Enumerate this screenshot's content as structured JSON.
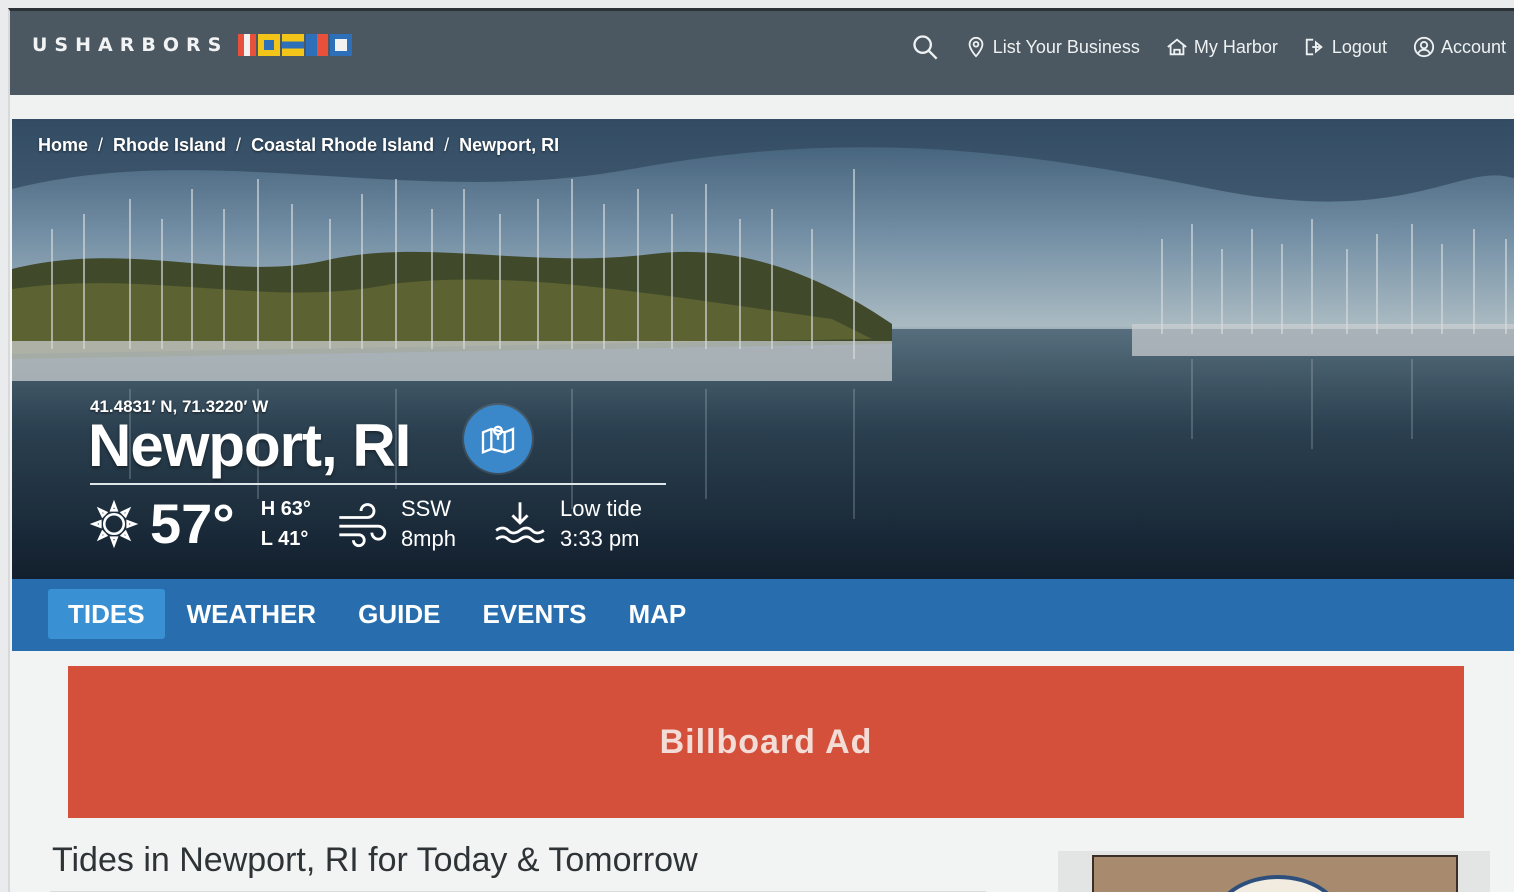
{
  "nav": {
    "logo_text": "USHARBORS",
    "items": [
      {
        "label": "List Your Business",
        "icon": "location-pin-icon"
      },
      {
        "label": "My Harbor",
        "icon": "home-icon"
      },
      {
        "label": "Logout",
        "icon": "logout-icon"
      },
      {
        "label": "Account",
        "icon": "account-icon"
      }
    ]
  },
  "breadcrumb": [
    "Home",
    "Rhode Island",
    "Coastal Rhode Island",
    "Newport, RI"
  ],
  "hero": {
    "coords": "41.4831′ N, 71.3220′ W",
    "city": "Newport, RI",
    "temp": "57°",
    "high": "H 63°",
    "low": "L 41°",
    "wind_dir": "SSW",
    "wind_speed": "8mph",
    "tide_label": "Low tide",
    "tide_time": "3:33 pm"
  },
  "tabs": [
    {
      "label": "TIDES",
      "active": true
    },
    {
      "label": "WEATHER",
      "active": false
    },
    {
      "label": "GUIDE",
      "active": false
    },
    {
      "label": "EVENTS",
      "active": false
    },
    {
      "label": "MAP",
      "active": false
    }
  ],
  "ad": {
    "label": "Billboard Ad"
  },
  "section": {
    "title": "Tides in Newport, RI for Today & Tomorrow"
  },
  "colors": {
    "nav_bg": "#4b5861",
    "tab_bg": "#286eaf",
    "tab_active": "#3990d3",
    "ad_bg": "#d5503b"
  }
}
